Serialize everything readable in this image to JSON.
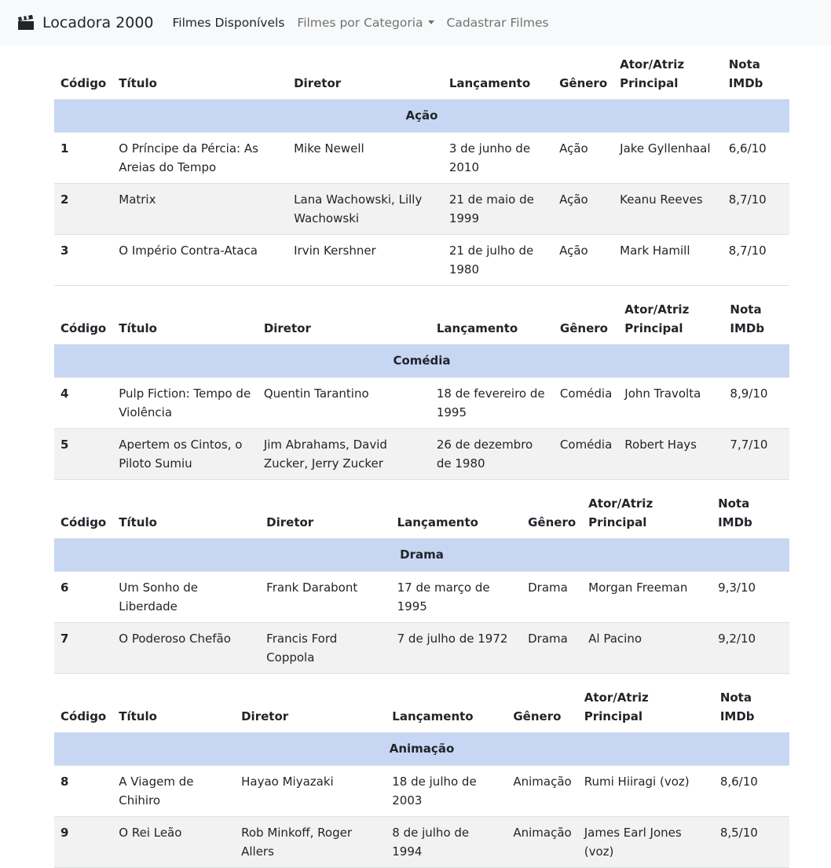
{
  "navbar": {
    "brand": "Locadora 2000",
    "links": [
      "Filmes Disponívels",
      "Filmes por Categoria",
      "Cadastrar Filmes"
    ]
  },
  "headers_wrapped": {
    "codigo": "Código",
    "titulo": "Título",
    "diretor": "Diretor",
    "lancamento": "Lançamento",
    "genero": "Gênero",
    "ator": "Ator/Atriz Principal",
    "nota": "Nota IMDb"
  },
  "tables": [
    {
      "category": "Ação",
      "rows": [
        {
          "codigo": "1",
          "titulo": "O Príncipe da Pércia: As Areias do Tempo",
          "diretor": "Mike Newell",
          "lancamento": "3 de junho de 2010",
          "genero": "Ação",
          "ator": "Jake Gyllenhaal",
          "nota": "6,6/10"
        },
        {
          "codigo": "2",
          "titulo": "Matrix",
          "diretor": "Lana Wachowski, Lilly Wachowski",
          "lancamento": "21 de maio de 1999",
          "genero": "Ação",
          "ator": "Keanu Reeves",
          "nota": "8,7/10"
        },
        {
          "codigo": "3",
          "titulo": "O Império Contra-Ataca",
          "diretor": "Irvin Kershner",
          "lancamento": "21 de julho de 1980",
          "genero": "Ação",
          "ator": "Mark Hamill",
          "nota": "8,7/10"
        }
      ]
    },
    {
      "category": "Comédia",
      "rows": [
        {
          "codigo": "4",
          "titulo": "Pulp Fiction: Tempo de Violência",
          "diretor": "Quentin Tarantino",
          "lancamento": "18 de fevereiro de 1995",
          "genero": "Comédia",
          "ator": "John Travolta",
          "nota": "8,9/10"
        },
        {
          "codigo": "5",
          "titulo": "Apertem os Cintos, o Piloto Sumiu",
          "diretor": "Jim Abrahams, David Zucker, Jerry Zucker",
          "lancamento": "26 de dezembro de 1980",
          "genero": "Comédia",
          "ator": "Robert Hays",
          "nota": "7,7/10"
        }
      ]
    },
    {
      "category": "Drama",
      "rows": [
        {
          "codigo": "6",
          "titulo": "Um Sonho de Liberdade",
          "diretor": "Frank Darabont",
          "lancamento": "17 de março de 1995",
          "genero": "Drama",
          "ator": "Morgan Freeman",
          "nota": "9,3/10"
        },
        {
          "codigo": "7",
          "titulo": "O Poderoso Chefão",
          "diretor": "Francis Ford Coppola",
          "lancamento": "7 de julho de 1972",
          "genero": "Drama",
          "ator": "Al Pacino",
          "nota": "9,2/10"
        }
      ]
    },
    {
      "category": "Animação",
      "rows": [
        {
          "codigo": "8",
          "titulo": "A Viagem de Chihiro",
          "diretor": "Hayao Miyazaki",
          "lancamento": "18 de julho de 2003",
          "genero": "Animação",
          "ator": "Rumi Hiiragi (voz)",
          "nota": "8,6/10"
        },
        {
          "codigo": "9",
          "titulo": "O Rei Leão",
          "diretor": "Rob Minkoff, Roger Allers",
          "lancamento": "8 de julho de 1994",
          "genero": "Animação",
          "ator": "James Earl Jones (voz)",
          "nota": "8,5/10"
        }
      ]
    }
  ]
}
